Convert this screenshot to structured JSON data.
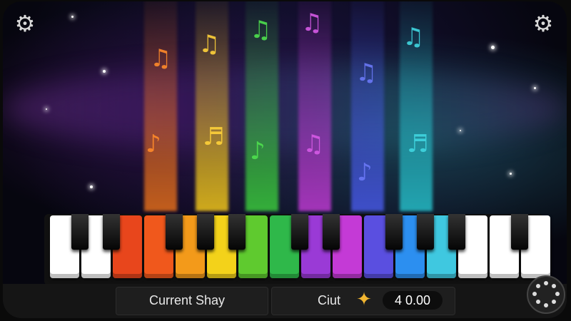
{
  "settings": {
    "left_icon": "gear-icon",
    "right_icon": "gear-icon"
  },
  "status": {
    "song_label": "Current Shay",
    "coin_label": "Ciut",
    "coin_icon": "sparkle-icon",
    "coin_value": "4 0.00"
  },
  "menu": {
    "icon": "dotted-ring-icon"
  },
  "colors": {
    "beams": [
      "#ff7a1a",
      "#ffd21a",
      "#3dd63d",
      "#c83cdc",
      "#4a5cf0",
      "#27c8d2"
    ],
    "keys": [
      "#ffffff",
      "#ffffff",
      "#e8461c",
      "#f0581c",
      "#f39a1a",
      "#f3d21a",
      "#5fca2f",
      "#2fb84a",
      "#9a3ad6",
      "#c43ad6",
      "#5a4fe0",
      "#2c8ff0",
      "#3fc8e0",
      "#ffffff",
      "#ffffff",
      "#ffffff"
    ]
  }
}
